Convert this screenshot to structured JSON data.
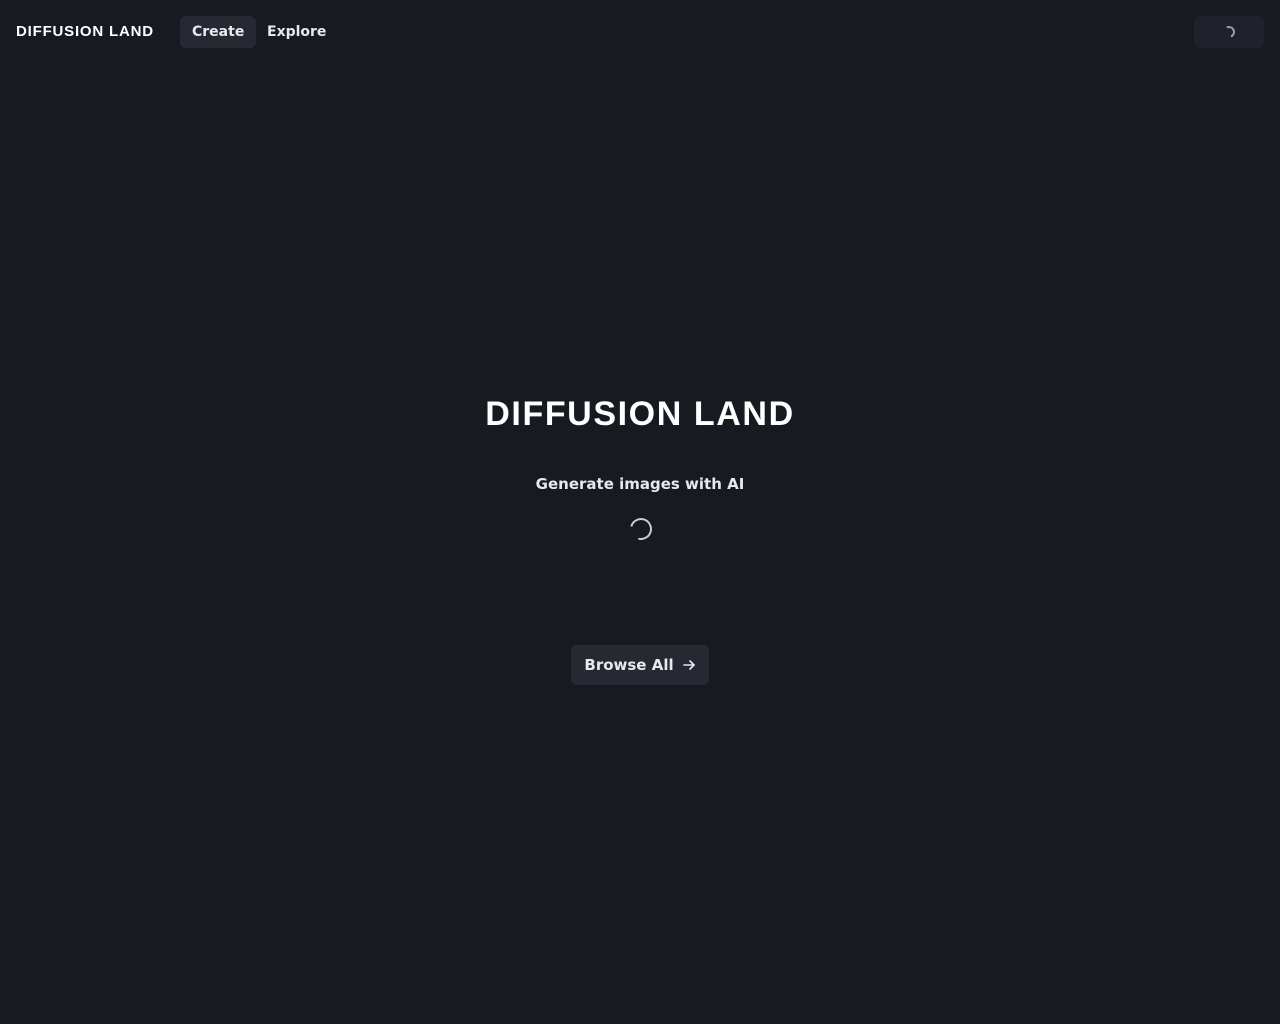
{
  "header": {
    "brand": "DIFFUSION LAND",
    "nav": [
      {
        "label": "Create",
        "active": true
      },
      {
        "label": "Explore",
        "active": false
      }
    ],
    "account_state": "loading"
  },
  "hero": {
    "title": "DIFFUSION LAND",
    "subtitle": "Generate images with AI",
    "loading_indicator": "spinner"
  },
  "actions": {
    "browse_label": "Browse All",
    "browse_icon": "arrow-right-icon"
  },
  "colors": {
    "background": "#181a22",
    "button_bg": "#262932",
    "text": "#e8e9ee"
  }
}
